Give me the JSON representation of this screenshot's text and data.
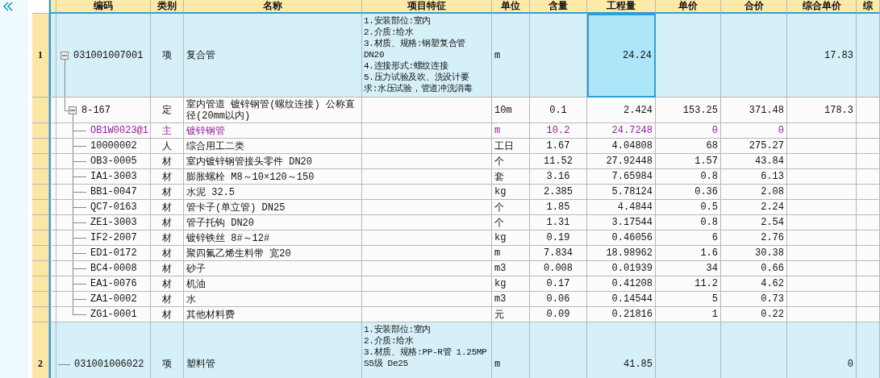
{
  "columns": [
    "编码",
    "类别",
    "名称",
    "项目特征",
    "单位",
    "含量",
    "工程量",
    "单价",
    "合价",
    "综合单价",
    "综"
  ],
  "rows": [
    {
      "number": "1",
      "kind": "item",
      "expanded": true,
      "quantity_focused": true,
      "code": "031001007001",
      "type": "项",
      "name": "复合管",
      "features": [
        "1.安装部位:室内",
        "2.介质:给水",
        "3.材质、规格:钢塑复合管",
        "DN20",
        "4.连接形式:螺纹连接",
        "5.压力试验及吹、洗设计要",
        "求:水压试验，管道冲洗消毒"
      ],
      "unit": "m",
      "quantity": "24.24",
      "composite_price": "17.83",
      "children": [
        {
          "kind": "quota",
          "expanded": true,
          "code": "8-167",
          "type": "定",
          "name": "室内管道 镀锌钢管(螺纹连接) 公称直径(20mm以内)",
          "unit": "10m",
          "content": "0.1",
          "quantity": "2.424",
          "unit_price": "153.25",
          "total_price": "371.48",
          "composite_price": "178.3",
          "children": [
            {
              "kind": "main_material",
              "code": "OB1W0023@1",
              "type": "主",
              "name": "镀锌钢管",
              "unit": "m",
              "content": "10.2",
              "quantity": "24.7248",
              "unit_price": "0",
              "total_price": "0"
            },
            {
              "kind": "resource",
              "code": "10000002",
              "type": "人",
              "name": "综合用工二类",
              "unit": "工日",
              "content": "1.67",
              "quantity": "4.04808",
              "unit_price": "68",
              "total_price": "275.27"
            },
            {
              "kind": "resource",
              "code": "OB3-0005",
              "type": "材",
              "name": "室内镀锌钢管接头零件 DN20",
              "unit": "个",
              "content": "11.52",
              "quantity": "27.92448",
              "unit_price": "1.57",
              "total_price": "43.84"
            },
            {
              "kind": "resource",
              "code": "IA1-3003",
              "type": "材",
              "name": "膨胀螺栓 M8～10×120～150",
              "unit": "套",
              "content": "3.16",
              "quantity": "7.65984",
              "unit_price": "0.8",
              "total_price": "6.13"
            },
            {
              "kind": "resource",
              "code": "BB1-0047",
              "type": "材",
              "name": "水泥 32.5",
              "unit": "kg",
              "content": "2.385",
              "quantity": "5.78124",
              "unit_price": "0.36",
              "total_price": "2.08"
            },
            {
              "kind": "resource",
              "code": "QC7-0163",
              "type": "材",
              "name": "管卡子(单立管) DN25",
              "unit": "个",
              "content": "1.85",
              "quantity": "4.4844",
              "unit_price": "0.5",
              "total_price": "2.24"
            },
            {
              "kind": "resource",
              "code": "ZE1-3003",
              "type": "材",
              "name": "管子托钩 DN20",
              "unit": "个",
              "content": "1.31",
              "quantity": "3.17544",
              "unit_price": "0.8",
              "total_price": "2.54"
            },
            {
              "kind": "resource",
              "code": "IF2-2007",
              "type": "材",
              "name": "镀锌铁丝 8#～12#",
              "unit": "kg",
              "content": "0.19",
              "quantity": "0.46056",
              "unit_price": "6",
              "total_price": "2.76"
            },
            {
              "kind": "resource",
              "code": "ED1-0172",
              "type": "材",
              "name": "聚四氟乙烯生料带 宽20",
              "unit": "m",
              "content": "7.834",
              "quantity": "18.98962",
              "unit_price": "1.6",
              "total_price": "30.38"
            },
            {
              "kind": "resource",
              "code": "BC4-0008",
              "type": "材",
              "name": "砂子",
              "unit": "m3",
              "content": "0.008",
              "quantity": "0.01939",
              "unit_price": "34",
              "total_price": "0.66"
            },
            {
              "kind": "resource",
              "code": "EA1-0076",
              "type": "材",
              "name": "机油",
              "unit": "kg",
              "content": "0.17",
              "quantity": "0.41208",
              "unit_price": "11.2",
              "total_price": "4.62"
            },
            {
              "kind": "resource",
              "code": "ZA1-0002",
              "type": "材",
              "name": "水",
              "unit": "m3",
              "content": "0.06",
              "quantity": "0.14544",
              "unit_price": "5",
              "total_price": "0.73"
            },
            {
              "kind": "resource",
              "code": "ZG1-0001",
              "type": "材",
              "name": "其他材料费",
              "unit": "元",
              "content": "0.09",
              "quantity": "0.21816",
              "unit_price": "1",
              "total_price": "0.22"
            }
          ]
        }
      ]
    },
    {
      "number": "2",
      "kind": "item",
      "quantity_focused": false,
      "code": "031001006022",
      "type": "项",
      "name": "塑料管",
      "features": [
        "1.安装部位:室内",
        "2.介质:给水",
        "3.材质、规格:PP-R管 1.25MP",
        "S5级 De25"
      ],
      "unit": "m",
      "quantity": "41.85",
      "composite_price": "0"
    }
  ]
}
